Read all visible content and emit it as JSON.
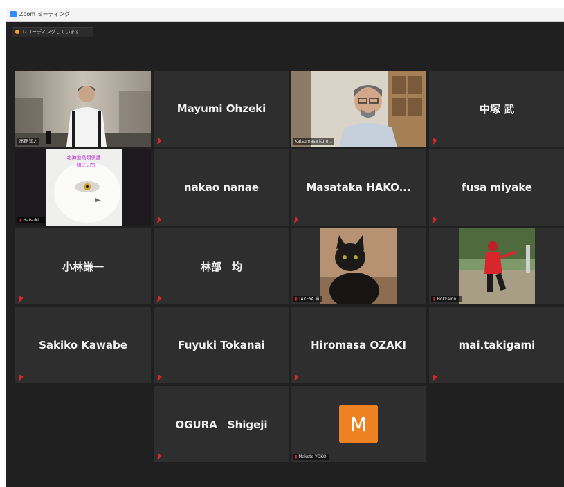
{
  "window": {
    "title": "Zoom ミーティング"
  },
  "recording": {
    "label": "レコーディングしています..."
  },
  "tiles": [
    {
      "name": "",
      "video": true,
      "label": "高野 知之"
    },
    {
      "name": "Mayumi Ohzeki"
    },
    {
      "name": "",
      "video": true,
      "label": "Katsumasa Kuro..."
    },
    {
      "name": "中塚 武"
    },
    {
      "name": "",
      "video": true,
      "label": "Hatsuki...",
      "overlay_text": [
        "北海道鳥類保護",
        "一緒に研究"
      ]
    },
    {
      "name": "nakao nanae"
    },
    {
      "name": "Masataka HAKO..."
    },
    {
      "name": "fusa miyake"
    },
    {
      "name": "小林謙一"
    },
    {
      "name": "林部　均"
    },
    {
      "name": "",
      "video": true,
      "label": "TAKEYA 猫"
    },
    {
      "name": "",
      "video": true,
      "label": "Hokkaido..."
    },
    {
      "name": "Sakiko Kawabe"
    },
    {
      "name": "Fuyuki Tokanai"
    },
    {
      "name": "Hiromasa OZAKI"
    },
    {
      "name": "mai.takigami"
    },
    {
      "name": "OGURA　Shigeji"
    },
    {
      "name": "",
      "avatar_letter": "M",
      "label": "Makoto YOKOI"
    }
  ],
  "colors": {
    "app_bg": "#202020",
    "tile_bg": "#2e2e2e",
    "active_speaker": "#d7d65a",
    "muted": "#e0262a",
    "avatar": "#ee8121",
    "recording_dot": "#ff9b1f"
  },
  "icons": {
    "app": "zoom-icon",
    "recording": "record-dot-icon",
    "mute": "muted-mic-icon"
  }
}
